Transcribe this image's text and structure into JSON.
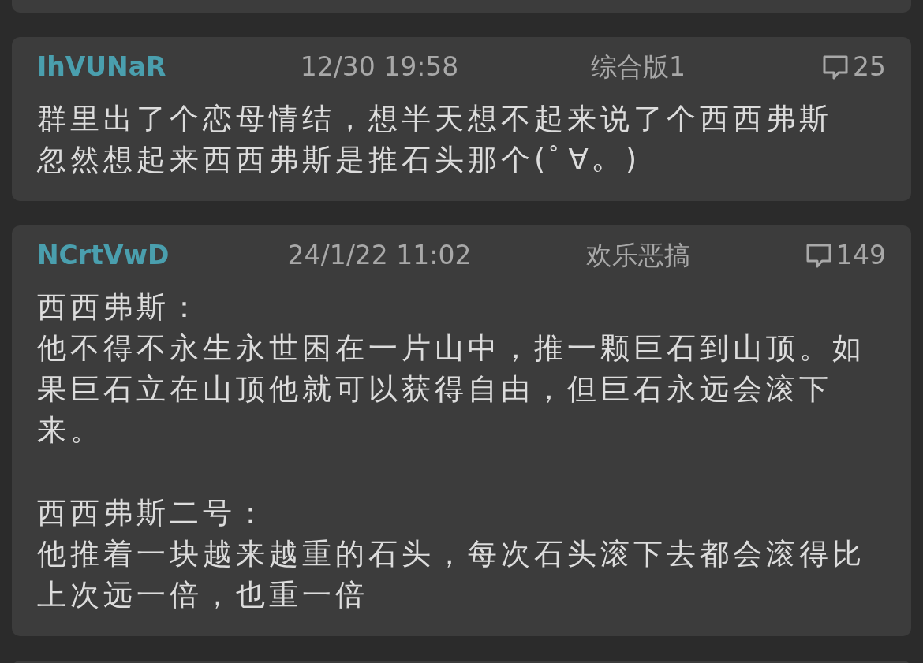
{
  "posts": [
    {
      "user_id": "IhVUNaR",
      "time": "12/30 19:58",
      "board": "综合版1",
      "replies": "25",
      "paragraphs": [
        [
          "群里出了个恋母情结，想半天想不起来说了个西西弗斯",
          "忽然想起来西西弗斯是推石头那个(ﾟ∀。)"
        ]
      ]
    },
    {
      "user_id": "NCrtVwD",
      "time": "24/1/22 11:02",
      "board": "欢乐恶搞",
      "replies": "149",
      "paragraphs": [
        [
          "西西弗斯：",
          "他不得不永生永世困在一片山中，推一颗巨石到山顶。如果巨石立在山顶他就可以获得自由，但巨石永远会滚下来。"
        ],
        [
          "西西弗斯二号：",
          "他推着一块越来越重的石头，每次石头滚下去都会滚得比上次远一倍，也重一倍"
        ]
      ]
    }
  ]
}
